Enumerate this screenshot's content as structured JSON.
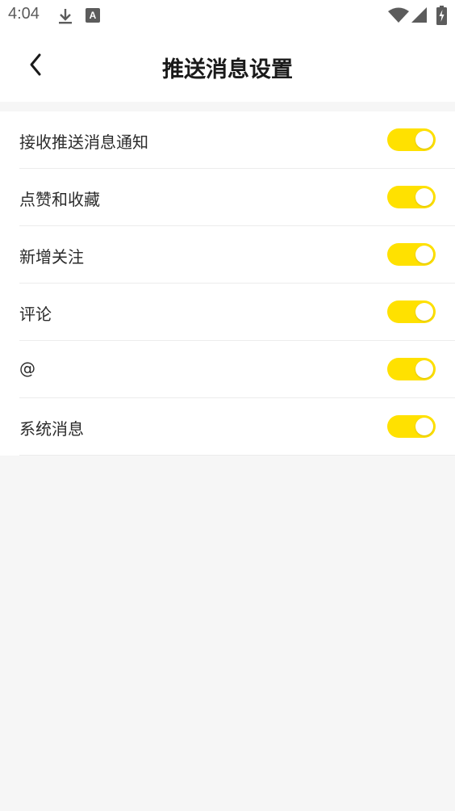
{
  "status_bar": {
    "time": "4:04",
    "icons": [
      "download-icon",
      "keyboard-a-icon",
      "wifi-icon",
      "cellular-signal-icon",
      "battery-charging-icon"
    ]
  },
  "header": {
    "title": "推送消息设置",
    "back_icon": "chevron-left-icon"
  },
  "colors": {
    "toggle_on": "#ffe100",
    "page_background": "#f6f6f6",
    "row_background": "#ffffff"
  },
  "settings": [
    {
      "label": "接收推送消息通知",
      "enabled": true
    },
    {
      "label": "点赞和收藏",
      "enabled": true
    },
    {
      "label": "新增关注",
      "enabled": true
    },
    {
      "label": "评论",
      "enabled": true
    },
    {
      "label": "@",
      "enabled": true
    },
    {
      "label": "系统消息",
      "enabled": true
    }
  ]
}
